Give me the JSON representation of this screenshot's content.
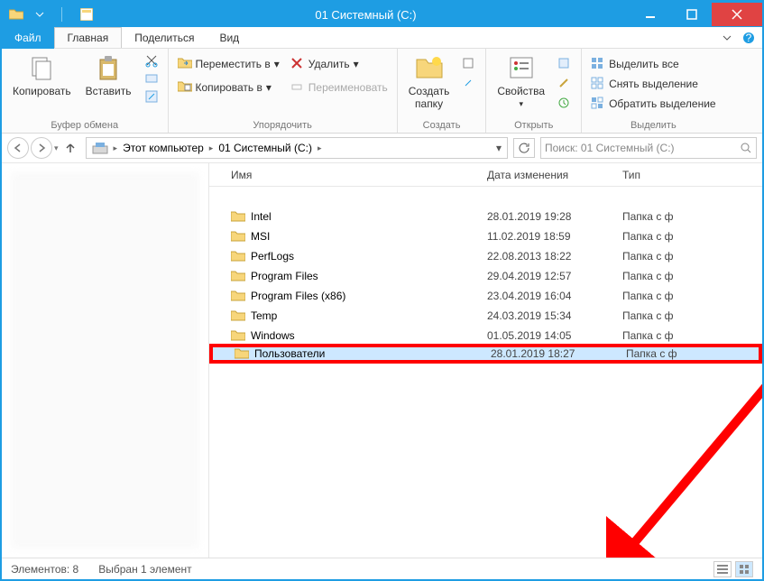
{
  "title": "01 Системный (С:)",
  "menu": {
    "file": "Файл",
    "tabs": [
      "Главная",
      "Поделиться",
      "Вид"
    ]
  },
  "ribbon": {
    "clipboard": {
      "copy": "Копировать",
      "paste": "Вставить",
      "label": "Буфер обмена"
    },
    "organize": {
      "move_to": "Переместить в",
      "copy_to": "Копировать в",
      "delete": "Удалить",
      "rename": "Переименовать",
      "label": "Упорядочить"
    },
    "new": {
      "new_folder": "Создать\nпапку",
      "label": "Создать"
    },
    "open": {
      "properties": "Свойства",
      "label": "Открыть"
    },
    "select": {
      "select_all": "Выделить все",
      "select_none": "Снять выделение",
      "invert": "Обратить выделение",
      "label": "Выделить"
    }
  },
  "breadcrumbs": [
    "Этот компьютер",
    "01 Системный (С:)"
  ],
  "search_placeholder": "Поиск: 01 Системный (С:)",
  "columns": {
    "name": "Имя",
    "date": "Дата изменения",
    "type": "Тип"
  },
  "items": [
    {
      "name": "Intel",
      "date": "28.01.2019 19:28",
      "type": "Папка с ф"
    },
    {
      "name": "MSI",
      "date": "11.02.2019 18:59",
      "type": "Папка с ф"
    },
    {
      "name": "PerfLogs",
      "date": "22.08.2013 18:22",
      "type": "Папка с ф"
    },
    {
      "name": "Program Files",
      "date": "29.04.2019 12:57",
      "type": "Папка с ф"
    },
    {
      "name": "Program Files (x86)",
      "date": "23.04.2019 16:04",
      "type": "Папка с ф"
    },
    {
      "name": "Temp",
      "date": "24.03.2019 15:34",
      "type": "Папка с ф"
    },
    {
      "name": "Windows",
      "date": "01.05.2019 14:05",
      "type": "Папка с ф"
    },
    {
      "name": "Пользователи",
      "date": "28.01.2019 18:27",
      "type": "Папка с ф"
    }
  ],
  "status": {
    "elements": "Элементов: 8",
    "selected": "Выбран 1 элемент"
  }
}
